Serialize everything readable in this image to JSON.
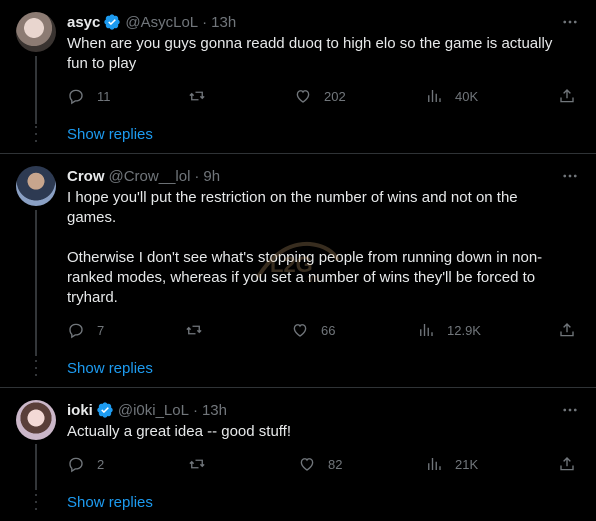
{
  "tweets": [
    {
      "name": "asyc",
      "verified": true,
      "handle": "@AsycLoL",
      "time": "13h",
      "text": "When are you guys gonna readd duoq to high elo so the game is actually fun to play",
      "replies": "11",
      "retweets": "",
      "likes": "202",
      "views": "40K",
      "show_replies": "Show replies"
    },
    {
      "name": "Crow",
      "verified": false,
      "handle": "@Crow__lol",
      "time": "9h",
      "text": "I hope you'll put the restriction on the number of wins and not on the games.\n\nOtherwise I don't see what's stopping people from running down in non-ranked modes, whereas if you set a number of wins they'll be forced to tryhard.",
      "replies": "7",
      "retweets": "",
      "likes": "66",
      "views": "12.9K",
      "show_replies": "Show replies"
    },
    {
      "name": "ioki",
      "verified": true,
      "handle": "@i0ki_LoL",
      "time": "13h",
      "text": "Actually a great idea -- good stuff!",
      "replies": "2",
      "retweets": "",
      "likes": "82",
      "views": "21K",
      "show_replies": "Show replies"
    }
  ],
  "colors": {
    "background": "#000000",
    "text": "#e7e9ea",
    "muted": "#71767b",
    "link": "#1d9bf0",
    "divider": "#2f3336",
    "verified": "#1d9bf0"
  },
  "icons": [
    "reply-icon",
    "retweet-icon",
    "like-icon",
    "views-icon",
    "share-icon",
    "more-icon",
    "verified-badge-icon"
  ]
}
